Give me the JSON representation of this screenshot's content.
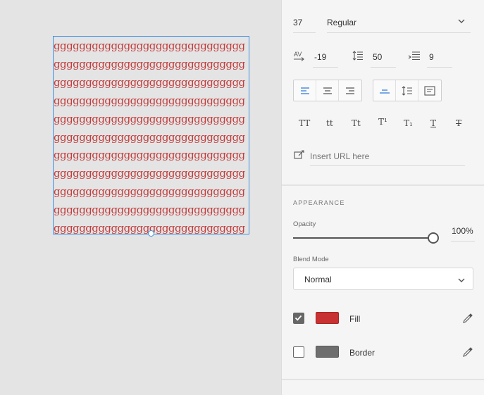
{
  "canvas": {
    "text_lines": [
      "ggggggggggggggggggggggggggggggggg",
      "ggggggggggggggggggggggggggggggggg",
      "ggggggggggggggggggggggggggggggggg",
      "ggggggggggggggggggggggggggggggggg",
      "ggggggggggggggggggggggggggggggggg",
      "ggggggggggggggggggggggggggggggggg",
      "ggggggggggggggggggggggggggggggggg",
      "ggggggggggggggggggggggggggggggggg",
      "ggggggggggggggggggggggggggggggggg",
      "ggggggggggggggggggggggggggggggggg",
      "ggggg"
    ],
    "text_color": "#c33d3d",
    "selection_color": "#3d8fe0"
  },
  "text_panel": {
    "font_size": "37",
    "font_weight": "Regular",
    "char_spacing": "-19",
    "line_spacing": "50",
    "paragraph_spacing": "9",
    "typo_buttons": [
      "TT",
      "tt",
      "Tt",
      "T¹",
      "T₁",
      "T",
      "T"
    ],
    "url_placeholder": "Insert URL here"
  },
  "appearance": {
    "section_title": "APPEARANCE",
    "opacity_label": "Opacity",
    "opacity_value": "100%",
    "opacity_level": 1.0,
    "blend_label": "Blend Mode",
    "blend_value": "Normal",
    "fill_label": "Fill",
    "fill_color": "#c83232",
    "fill_checked": true,
    "border_label": "Border",
    "border_color": "#6e6e6e",
    "border_checked": false
  }
}
